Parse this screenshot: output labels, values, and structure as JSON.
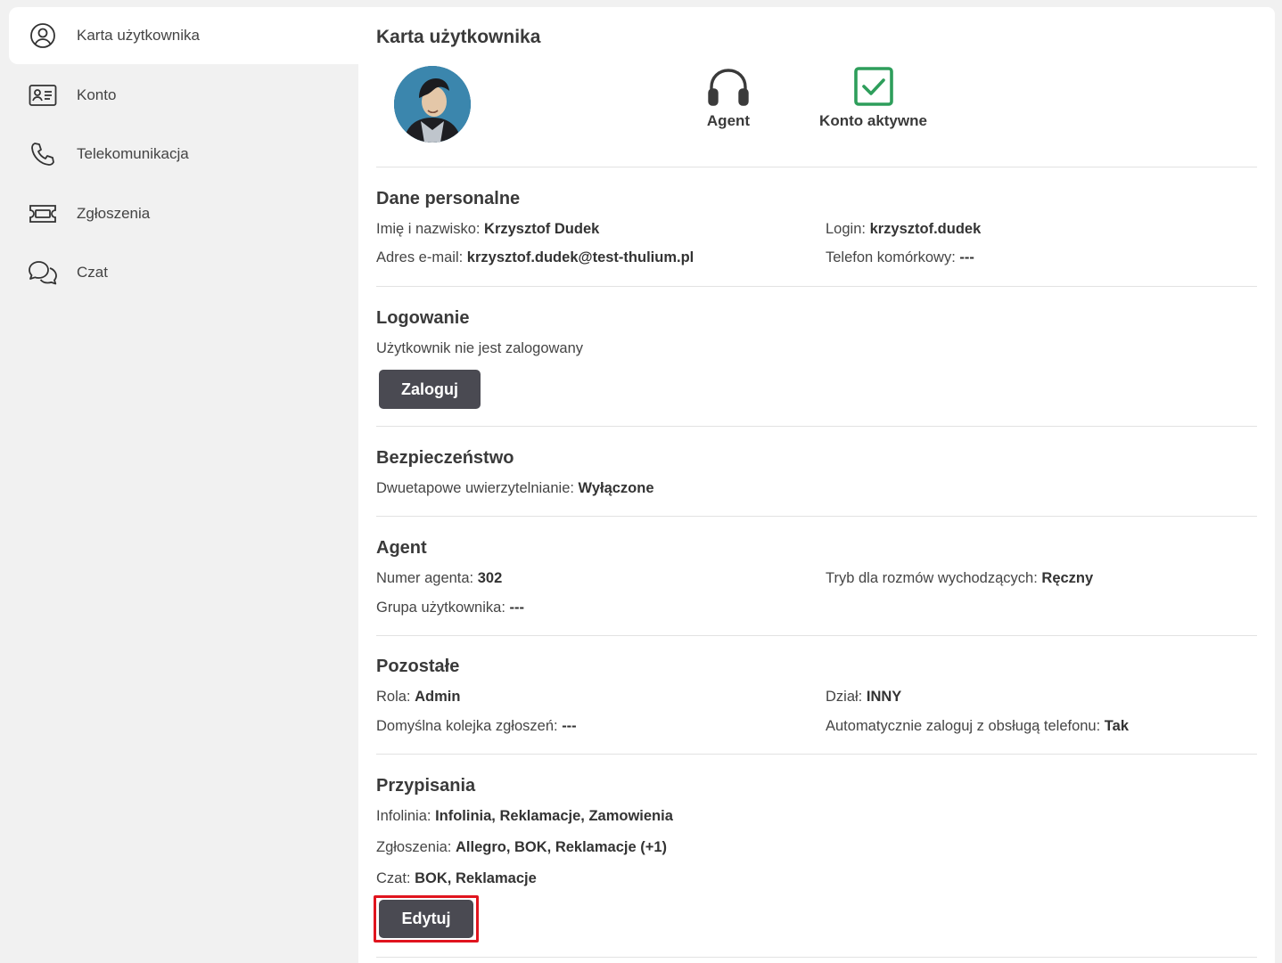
{
  "sidebar": {
    "items": [
      {
        "label": "Karta użytkownika",
        "icon": "user-circle-icon"
      },
      {
        "label": "Konto",
        "icon": "id-card-icon"
      },
      {
        "label": "Telekomunikacja",
        "icon": "phone-icon"
      },
      {
        "label": "Zgłoszenia",
        "icon": "ticket-icon"
      },
      {
        "label": "Czat",
        "icon": "chat-bubbles-icon"
      }
    ]
  },
  "header": {
    "title": "Karta użytkownika",
    "role_label": "Agent",
    "account_status": "Konto aktywne",
    "status_color": "#2e9e5b"
  },
  "personal": {
    "title": "Dane personalne",
    "name_label": "Imię i nazwisko:",
    "name_value": "Krzysztof Dudek",
    "login_label": "Login:",
    "login_value": "krzysztof.dudek",
    "email_label": "Adres e-mail:",
    "email_value": "krzysztof.dudek@test-thulium.pl",
    "phone_label": "Telefon komórkowy:",
    "phone_value": "---"
  },
  "login": {
    "title": "Logowanie",
    "status": "Użytkownik nie jest zalogowany",
    "button": "Zaloguj"
  },
  "security": {
    "title": "Bezpieczeństwo",
    "twofa_label": "Dwuetapowe uwierzytelnianie:",
    "twofa_value": "Wyłączone"
  },
  "agent": {
    "title": "Agent",
    "number_label": "Numer agenta:",
    "number_value": "302",
    "mode_label": "Tryb dla rozmów wychodzących:",
    "mode_value": "Ręczny",
    "group_label": "Grupa użytkownika:",
    "group_value": "---"
  },
  "other": {
    "title": "Pozostałe",
    "role_label": "Rola:",
    "role_value": "Admin",
    "dept_label": "Dział:",
    "dept_value": "INNY",
    "queue_label": "Domyślna kolejka zgłoszeń:",
    "queue_value": "---",
    "autolog_label": "Automatycznie zaloguj z obsługą telefonu:",
    "autolog_value": "Tak"
  },
  "assignments": {
    "title": "Przypisania",
    "infolinia_label": "Infolinia:",
    "infolinia_value": "Infolinia, Reklamacje, Zamowienia",
    "tickets_label": "Zgłoszenia:",
    "tickets_value": "Allegro, BOK, Reklamacje (+1)",
    "chat_label": "Czat:",
    "chat_value": "BOK, Reklamacje",
    "button": "Edytuj",
    "highlight_color": "#e0141e"
  }
}
